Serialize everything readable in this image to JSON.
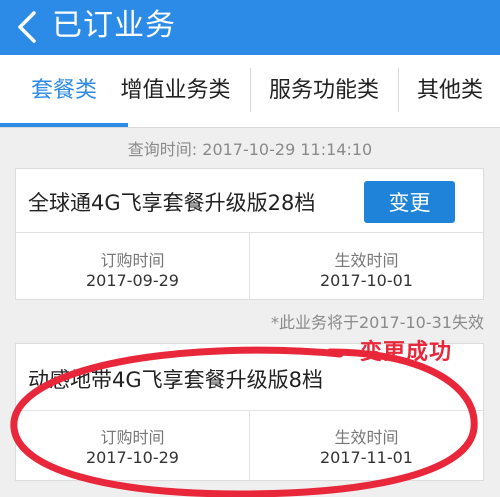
{
  "header": {
    "title": "已订业务",
    "back_icon": "chevron-left-icon",
    "background_color": "#2c8be6"
  },
  "tabs": [
    {
      "label": "套餐类",
      "active": true
    },
    {
      "label": "增值业务类",
      "active": false
    },
    {
      "label": "服务功能类",
      "active": false
    },
    {
      "label": "其他类",
      "active": false
    }
  ],
  "query_time": "查询时间: 2017-10-29   11:14:10",
  "cards": [
    {
      "plan_name": "全球通4G飞享套餐升级版28档",
      "action_label": "变更",
      "order_time_label": "订购时间",
      "order_time": "2017-09-29",
      "effective_time_label": "生效时间",
      "effective_time": "2017-10-01"
    },
    {
      "plan_name": "动感地带4G飞享套餐升级版8档",
      "order_time_label": "订购时间",
      "order_time": "2017-10-29",
      "effective_time_label": "生效时间",
      "effective_time": "2017-11-01"
    }
  ],
  "expire_note": "*此业务将于2017-10-31失效",
  "annotation": {
    "text": "变更成功",
    "color": "#e8283a"
  }
}
